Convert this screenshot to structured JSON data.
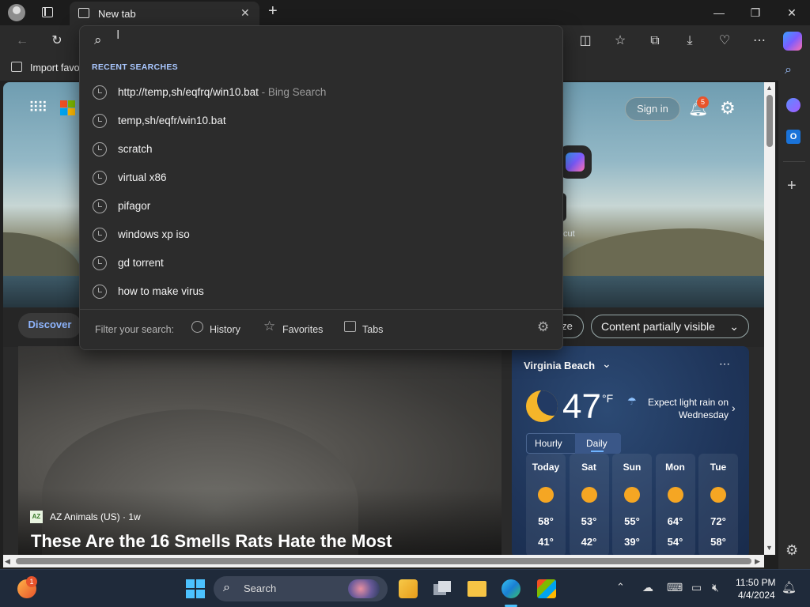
{
  "browser": {
    "tab_title": "New tab",
    "favorites_item": "Import favo"
  },
  "dropdown": {
    "recent_header": "RECENT SEARCHES",
    "items": [
      {
        "text": "http://temp,sh/eqfrq/win10.bat",
        "suffix": " - Bing Search"
      },
      {
        "text": "temp,sh/eqfr/win10.bat",
        "suffix": ""
      },
      {
        "text": "scratch",
        "suffix": ""
      },
      {
        "text": "virtual x86",
        "suffix": ""
      },
      {
        "text": "pifagor",
        "suffix": ""
      },
      {
        "text": "windows xp iso",
        "suffix": ""
      },
      {
        "text": "gd torrent",
        "suffix": ""
      },
      {
        "text": "how to make virus",
        "suffix": ""
      }
    ],
    "filter_label": "Filter your search:",
    "filter_history": "History",
    "filter_favorites": "Favorites",
    "filter_tabs": "Tabs"
  },
  "newtab": {
    "sign_in": "Sign in",
    "notif_count": "5",
    "shortcut_partial": "cut",
    "discover_tab": "Discover",
    "personalize_partial": "ze",
    "content_visibility": "Content partially visible"
  },
  "article": {
    "source": "AZ Animals (US) · 1w",
    "source_logo": "AZ",
    "headline": "These Are the 16 Smells Rats Hate the Most"
  },
  "weather": {
    "location": "Virginia Beach",
    "temp": "47",
    "unit": "°F",
    "forecast_text": "Expect light rain on Wednesday",
    "tab_hourly": "Hourly",
    "tab_daily": "Daily",
    "days": [
      {
        "name": "Today",
        "hi": "58°",
        "lo": "41°"
      },
      {
        "name": "Sat",
        "hi": "53°",
        "lo": "42°"
      },
      {
        "name": "Sun",
        "hi": "55°",
        "lo": "39°"
      },
      {
        "name": "Mon",
        "hi": "64°",
        "lo": "54°"
      },
      {
        "name": "Tue",
        "hi": "72°",
        "lo": "58°"
      }
    ]
  },
  "taskbar": {
    "search_label": "Search",
    "edge_notif": "1",
    "time": "11:50 PM",
    "date": "4/4/2024"
  },
  "colors": {
    "accent": "#a9c7ff",
    "taskbar_bg": "#1f2a3a",
    "notification": "#e8532b"
  }
}
